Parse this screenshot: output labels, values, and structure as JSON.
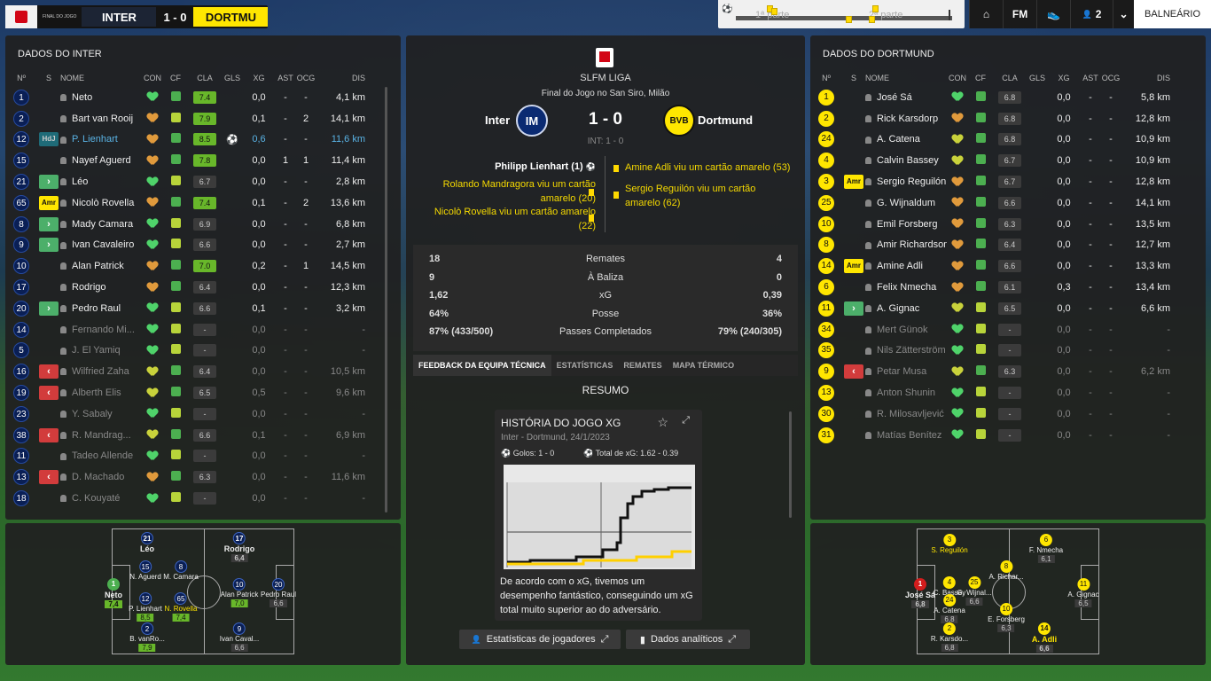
{
  "header": {
    "match_label": "FINAL DO JOGO",
    "home": "INTER",
    "away": "DORTMU",
    "score": "1 - 0",
    "timeline": {
      "first_half": "1ª parte",
      "second_half": "2ª parte"
    },
    "nav": {
      "home_icon": "home-icon",
      "fm": "FM",
      "shoe_icon": "boot-icon",
      "people": "2",
      "chevron": "chevron-down-icon",
      "cta": "BALNEÁRIO"
    }
  },
  "inter": {
    "title": "DADOS DO INTER",
    "cols": [
      "Nº",
      "S",
      "NOME",
      "CON",
      "CF",
      "CLA",
      "GLS",
      "XG",
      "AST",
      "OCG",
      "DIS"
    ],
    "players": [
      {
        "n": "1",
        "s": "",
        "name": "Neto",
        "con": "g",
        "cf": "up",
        "cla": "7.4",
        "hi": true,
        "gls": "",
        "xg": "0,0",
        "ast": "-",
        "ocg": "-",
        "dis": "4,1 km"
      },
      {
        "n": "2",
        "s": "",
        "name": "Bart van Rooij",
        "con": "o",
        "cf": "dash",
        "cla": "7.9",
        "hi": true,
        "gls": "",
        "xg": "0,1",
        "ast": "-",
        "ocg": "2",
        "dis": "14,1 km"
      },
      {
        "n": "12",
        "s": "HdJ",
        "name": "P. Lienhart",
        "con": "o",
        "cf": "up",
        "cla": "8.5",
        "hi": true,
        "gls": "⚽",
        "xg": "0,6",
        "ast": "-",
        "ocg": "-",
        "dis": "11,6 km",
        "blue": true
      },
      {
        "n": "15",
        "s": "",
        "name": "Nayef Aguerd",
        "con": "o",
        "cf": "up",
        "cla": "7.8",
        "hi": true,
        "gls": "",
        "xg": "0,0",
        "ast": "1",
        "ocg": "1",
        "dis": "11,4 km"
      },
      {
        "n": "21",
        "s": ">",
        "name": "Léo",
        "con": "g",
        "cf": "dash",
        "cla": "6.7",
        "hi": false,
        "gls": "",
        "xg": "0,0",
        "ast": "-",
        "ocg": "-",
        "dis": "2,8 km"
      },
      {
        "n": "65",
        "s": "Amr",
        "name": "Nicolò Rovella",
        "con": "o",
        "cf": "up",
        "cla": "7.4",
        "hi": true,
        "gls": "",
        "xg": "0,1",
        "ast": "-",
        "ocg": "2",
        "dis": "13,6 km"
      },
      {
        "n": "8",
        "s": ">",
        "name": "Mady Camara",
        "con": "g",
        "cf": "dash",
        "cla": "6.9",
        "hi": false,
        "gls": "",
        "xg": "0,0",
        "ast": "-",
        "ocg": "-",
        "dis": "6,8 km"
      },
      {
        "n": "9",
        "s": ">",
        "name": "Ivan Cavaleiro",
        "con": "g",
        "cf": "dash",
        "cla": "6.6",
        "hi": false,
        "gls": "",
        "xg": "0,0",
        "ast": "-",
        "ocg": "-",
        "dis": "2,7 km"
      },
      {
        "n": "10",
        "s": "",
        "name": "Alan Patrick",
        "con": "o",
        "cf": "up",
        "cla": "7.0",
        "hi": true,
        "gls": "",
        "xg": "0,2",
        "ast": "-",
        "ocg": "1",
        "dis": "14,5 km"
      },
      {
        "n": "17",
        "s": "",
        "name": "Rodrigo",
        "con": "o",
        "cf": "up",
        "cla": "6.4",
        "hi": false,
        "gls": "",
        "xg": "0,0",
        "ast": "-",
        "ocg": "-",
        "dis": "12,3 km"
      },
      {
        "n": "20",
        "s": ">",
        "name": "Pedro Raul",
        "con": "g",
        "cf": "dash",
        "cla": "6.6",
        "hi": false,
        "gls": "",
        "xg": "0,1",
        "ast": "-",
        "ocg": "-",
        "dis": "3,2 km"
      },
      {
        "n": "14",
        "s": "",
        "name": "Fernando Mi...",
        "con": "g",
        "cf": "dash",
        "cla": "-",
        "hi": false,
        "gls": "",
        "xg": "0,0",
        "ast": "-",
        "ocg": "-",
        "dis": "-",
        "dim": true
      },
      {
        "n": "5",
        "s": "",
        "name": "J. El Yamiq",
        "con": "g",
        "cf": "dash",
        "cla": "-",
        "hi": false,
        "gls": "",
        "xg": "0,0",
        "ast": "-",
        "ocg": "-",
        "dis": "-",
        "dim": true
      },
      {
        "n": "16",
        "s": "<",
        "name": "Wilfried Zaha",
        "con": "y",
        "cf": "up",
        "cla": "6.4",
        "hi": false,
        "gls": "",
        "xg": "0,0",
        "ast": "-",
        "ocg": "-",
        "dis": "10,5 km",
        "dim": true
      },
      {
        "n": "19",
        "s": "<",
        "name": "Alberth Elis",
        "con": "y",
        "cf": "up",
        "cla": "6.5",
        "hi": false,
        "gls": "",
        "xg": "0,5",
        "ast": "-",
        "ocg": "-",
        "dis": "9,6 km",
        "dim": true
      },
      {
        "n": "23",
        "s": "",
        "name": "Y. Sabaly",
        "con": "g",
        "cf": "dash",
        "cla": "-",
        "hi": false,
        "gls": "",
        "xg": "0,0",
        "ast": "-",
        "ocg": "-",
        "dis": "-",
        "dim": true
      },
      {
        "n": "38",
        "s": "<",
        "name": "R. Mandrag...",
        "con": "y",
        "cf": "up",
        "cla": "6.6",
        "hi": false,
        "gls": "",
        "xg": "0,1",
        "ast": "-",
        "ocg": "-",
        "dis": "6,9 km",
        "dim": true
      },
      {
        "n": "11",
        "s": "",
        "name": "Tadeo Allende",
        "con": "g",
        "cf": "dash",
        "cla": "-",
        "hi": false,
        "gls": "",
        "xg": "0,0",
        "ast": "-",
        "ocg": "-",
        "dis": "-",
        "dim": true
      },
      {
        "n": "13",
        "s": "<",
        "name": "D. Machado",
        "con": "o",
        "cf": "up",
        "cla": "6.3",
        "hi": false,
        "gls": "",
        "xg": "0,0",
        "ast": "-",
        "ocg": "-",
        "dis": "11,6 km",
        "dim": true
      },
      {
        "n": "18",
        "s": "",
        "name": "C. Kouyaté",
        "con": "g",
        "cf": "dash",
        "cla": "-",
        "hi": false,
        "gls": "",
        "xg": "0,0",
        "ast": "-",
        "ocg": "-",
        "dis": "-",
        "dim": true
      }
    ],
    "pitch": [
      {
        "n": "1",
        "name": "Neto",
        "r": "7,4",
        "hi": true,
        "c": "g",
        "big": true
      },
      {
        "n": "21",
        "name": "Léo",
        "r": "",
        "hi": false,
        "c": "i",
        "big": true
      },
      {
        "n": "15",
        "name": "N. Aguerd",
        "r": "",
        "hi": false,
        "c": "i"
      },
      {
        "n": "12",
        "name": "P. Lienhart",
        "r": "8,5",
        "hi": true,
        "c": "i"
      },
      {
        "n": "2",
        "name": "B. vanRo...",
        "r": "7,9",
        "hi": true,
        "c": "i"
      },
      {
        "n": "8",
        "name": "M. Camara",
        "r": "",
        "hi": false,
        "c": "i"
      },
      {
        "n": "65",
        "name": "N. Rovella",
        "r": "7,4",
        "hi": true,
        "c": "i",
        "yellow": true
      },
      {
        "n": "17",
        "name": "Rodrigo",
        "r": "6,4",
        "hi": false,
        "c": "i",
        "big": true
      },
      {
        "n": "10",
        "name": "Alan Patrick",
        "r": "7,0",
        "hi": true,
        "c": "i"
      },
      {
        "n": "9",
        "name": "Ivan Caval...",
        "r": "6,6",
        "hi": false,
        "c": "i"
      },
      {
        "n": "20",
        "name": "Pedro Raul",
        "r": "6,6",
        "hi": false,
        "c": "i"
      }
    ]
  },
  "center": {
    "league": "SLFM LIGA",
    "subtitle": "Final do Jogo no San Siro, Milão",
    "home": "Inter",
    "away": "Dortmund",
    "score": "1 - 0",
    "ht": "INT: 1 - 0",
    "events_home": [
      {
        "t": "Philipp Lienhart (1)",
        "goal": true
      },
      {
        "t": "Rolando Mandragora viu um cartão amarelo (20)"
      },
      {
        "t": "Nicolò Rovella viu um cartão amarelo (22)"
      }
    ],
    "events_away": [
      {
        "t": "Amine Adli viu um cartão amarelo (53)"
      },
      {
        "t": "Sergio Reguilón viu um cartão amarelo (62)"
      }
    ],
    "stats": [
      {
        "l": "18",
        "m": "Remates",
        "r": "4"
      },
      {
        "l": "9",
        "m": "À Baliza",
        "r": "0"
      },
      {
        "l": "1,62",
        "m": "xG",
        "r": "0,39"
      },
      {
        "l": "64%",
        "m": "Posse",
        "r": "36%"
      },
      {
        "l": "87% (433/500)",
        "m": "Passes Completados",
        "r": "79% (240/305)"
      }
    ],
    "tabs": [
      "FEEDBACK DA EQUIPA TÉCNICA",
      "ESTATÍSTICAS",
      "REMATES",
      "MAPA TÉRMICO"
    ],
    "summary": "RESUMO",
    "card": {
      "title": "HISTÓRIA DO JOGO XG",
      "sub": "Inter - Dortmund, 24/1/2023",
      "goals": "Golos: 1 - 0",
      "xg": "Total de xG: 1.62 - 0.39",
      "text": "De acordo com o xG, tivemos um desempenho fantástico, conseguindo um xG total muito superior ao do adversário."
    },
    "buttons": [
      "Estatísticas de jogadores",
      "Dados analíticos"
    ]
  },
  "dortmund": {
    "title": "DADOS DO DORTMUND",
    "players": [
      {
        "n": "1",
        "s": "",
        "name": "José Sá",
        "con": "g",
        "cf": "up",
        "cla": "6.8",
        "xg": "0,0",
        "ast": "-",
        "ocg": "-",
        "dis": "5,8 km"
      },
      {
        "n": "2",
        "s": "",
        "name": "Rick Karsdorp",
        "con": "o",
        "cf": "up",
        "cla": "6.8",
        "xg": "0,0",
        "ast": "-",
        "ocg": "-",
        "dis": "12,8 km"
      },
      {
        "n": "24",
        "s": "",
        "name": "A. Catena",
        "con": "y",
        "cf": "up",
        "cla": "6.8",
        "xg": "0,0",
        "ast": "-",
        "ocg": "-",
        "dis": "10,9 km"
      },
      {
        "n": "4",
        "s": "",
        "name": "Calvin Bassey",
        "con": "y",
        "cf": "up",
        "cla": "6.7",
        "xg": "0,0",
        "ast": "-",
        "ocg": "-",
        "dis": "10,9 km"
      },
      {
        "n": "3",
        "s": "Amr",
        "name": "Sergio Reguilón",
        "con": "o",
        "cf": "up",
        "cla": "6.7",
        "xg": "0,0",
        "ast": "-",
        "ocg": "-",
        "dis": "12,8 km"
      },
      {
        "n": "25",
        "s": "",
        "name": "G. Wijnaldum",
        "con": "o",
        "cf": "up",
        "cla": "6.6",
        "xg": "0,0",
        "ast": "-",
        "ocg": "-",
        "dis": "14,1 km"
      },
      {
        "n": "10",
        "s": "",
        "name": "Emil Forsberg",
        "con": "o",
        "cf": "up",
        "cla": "6.3",
        "xg": "0,0",
        "ast": "-",
        "ocg": "-",
        "dis": "13,5 km"
      },
      {
        "n": "8",
        "s": "",
        "name": "Amir Richardson",
        "con": "o",
        "cf": "up",
        "cla": "6.4",
        "xg": "0,0",
        "ast": "-",
        "ocg": "-",
        "dis": "12,7 km"
      },
      {
        "n": "14",
        "s": "Amr",
        "name": "Amine Adli",
        "con": "o",
        "cf": "up",
        "cla": "6.6",
        "xg": "0,0",
        "ast": "-",
        "ocg": "-",
        "dis": "13,3 km"
      },
      {
        "n": "6",
        "s": "",
        "name": "Felix Nmecha",
        "con": "o",
        "cf": "up",
        "cla": "6.1",
        "xg": "0,3",
        "ast": "-",
        "ocg": "-",
        "dis": "13,4 km"
      },
      {
        "n": "11",
        "s": ">",
        "name": "A. Gignac",
        "con": "y",
        "cf": "dash",
        "cla": "6.5",
        "xg": "0,0",
        "ast": "-",
        "ocg": "-",
        "dis": "6,6 km"
      },
      {
        "n": "34",
        "s": "",
        "name": "Mert Günok",
        "con": "g",
        "cf": "dash",
        "cla": "-",
        "xg": "0,0",
        "ast": "-",
        "ocg": "-",
        "dis": "-",
        "dim": true
      },
      {
        "n": "35",
        "s": "",
        "name": "Nils Zätterström",
        "con": "g",
        "cf": "dash",
        "cla": "-",
        "xg": "0,0",
        "ast": "-",
        "ocg": "-",
        "dis": "-",
        "dim": true
      },
      {
        "n": "9",
        "s": "<",
        "name": "Petar Musa",
        "con": "y",
        "cf": "up",
        "cla": "6.3",
        "xg": "0,0",
        "ast": "-",
        "ocg": "-",
        "dis": "6,2 km",
        "dim": true
      },
      {
        "n": "13",
        "s": "",
        "name": "Anton Shunin",
        "con": "g",
        "cf": "dash",
        "cla": "-",
        "xg": "0,0",
        "ast": "-",
        "ocg": "-",
        "dis": "-",
        "dim": true
      },
      {
        "n": "30",
        "s": "",
        "name": "R. Milosavljević",
        "con": "g",
        "cf": "dash",
        "cla": "-",
        "xg": "0,0",
        "ast": "-",
        "ocg": "-",
        "dis": "-",
        "dim": true
      },
      {
        "n": "31",
        "s": "",
        "name": "Matías Benítez",
        "con": "g",
        "cf": "dash",
        "cla": "-",
        "xg": "0,0",
        "ast": "-",
        "ocg": "-",
        "dis": "-",
        "dim": true
      }
    ],
    "pitch": [
      {
        "n": "1",
        "name": "José Sá",
        "r": "6,8",
        "c": "r",
        "big": true
      },
      {
        "n": "3",
        "name": "S. Reguilón",
        "r": "",
        "c": "b",
        "yellow": true
      },
      {
        "n": "4",
        "name": "C. Bassey",
        "r": "",
        "c": "b"
      },
      {
        "n": "24",
        "name": "A. Catena",
        "r": "6,8",
        "c": "b"
      },
      {
        "n": "2",
        "name": "R. Karsdo...",
        "r": "6,8",
        "c": "b"
      },
      {
        "n": "25",
        "name": "G. Wijnal...",
        "r": "6,6",
        "c": "b"
      },
      {
        "n": "8",
        "name": "A. Richar...",
        "r": "",
        "c": "b"
      },
      {
        "n": "10",
        "name": "E. Forsberg",
        "r": "6,3",
        "c": "b"
      },
      {
        "n": "6",
        "name": "F. Nmecha",
        "r": "6,1",
        "c": "b"
      },
      {
        "n": "14",
        "name": "A. Adli",
        "r": "6,6",
        "c": "b",
        "yellow": true,
        "big": true
      },
      {
        "n": "11",
        "name": "A. Gignac",
        "r": "6,5",
        "c": "b"
      }
    ]
  }
}
